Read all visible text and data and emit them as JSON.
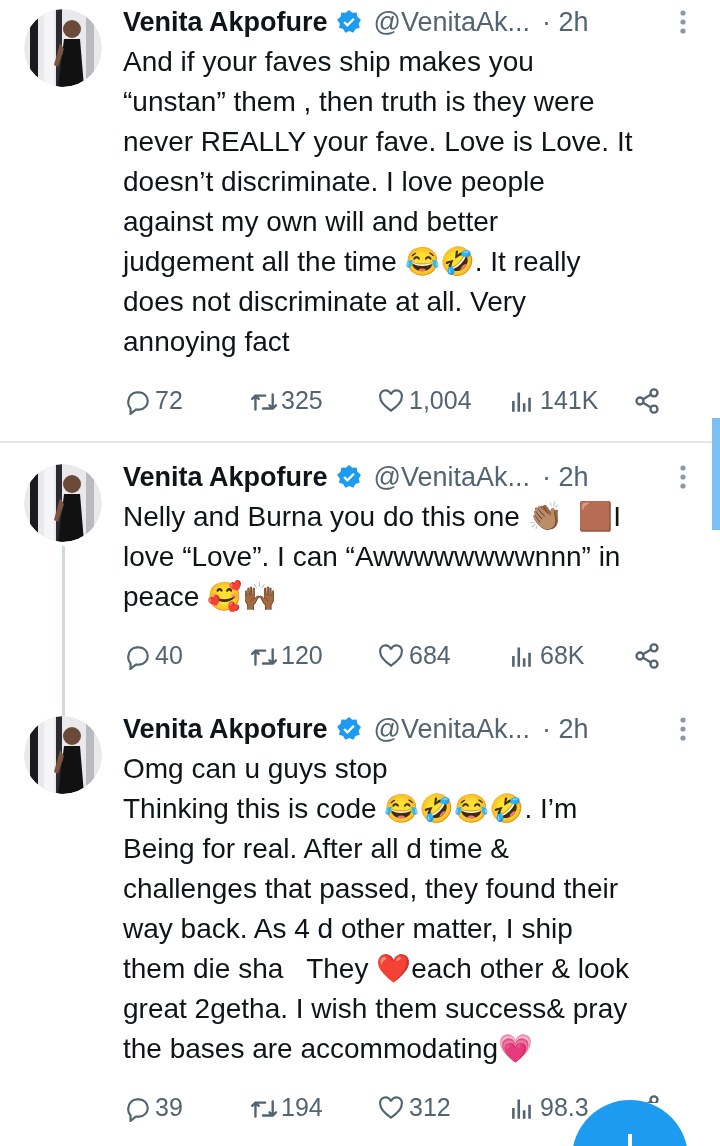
{
  "tweets": [
    {
      "name": "Venita Akpofure",
      "verified": true,
      "handle": "@VenitaAk...",
      "time": "· 2h",
      "thread_line": false,
      "body": [
        "And if your faves ship makes you",
        "“unstan” them , then truth is they were",
        "never REALLY your fave. Love is Love. It",
        "doesn’t discriminate. I love people",
        "against my own will and better",
        "judgement all the time 😂🤣. It really",
        "does not discriminate at all. Very",
        "annoying fact"
      ],
      "stats": {
        "replies": "72",
        "reposts": "325",
        "likes": "1,004",
        "views": "141K"
      },
      "divider": true
    },
    {
      "name": "Venita Akpofure",
      "verified": true,
      "handle": "@VenitaAk...",
      "time": "· 2h",
      "thread_line": true,
      "body": [
        "Nelly and Burna you do this one 👏🏽  🟫I",
        "love “Love”. I can “Awwwwwwwwnnn” in",
        "peace 🥰🙌🏾"
      ],
      "stats": {
        "replies": "40",
        "reposts": "120",
        "likes": "684",
        "views": "68K"
      },
      "divider": false
    },
    {
      "name": "Venita Akpofure",
      "verified": true,
      "handle": "@VenitaAk...",
      "time": "· 2h",
      "thread_line": false,
      "body": [
        "Omg can u guys stop",
        "Thinking this is code 😂🤣😂🤣. I’m",
        "Being for real. After all d time &",
        "challenges that passed, they found their",
        "way back. As 4 d other matter, I ship",
        "them die sha   They ❤️each other & look",
        "great 2getha. I wish them success& pray",
        "the bases are accommodating💗"
      ],
      "stats": {
        "replies": "39",
        "reposts": "194",
        "likes": "312",
        "views": "98.3"
      },
      "divider": false
    }
  ]
}
